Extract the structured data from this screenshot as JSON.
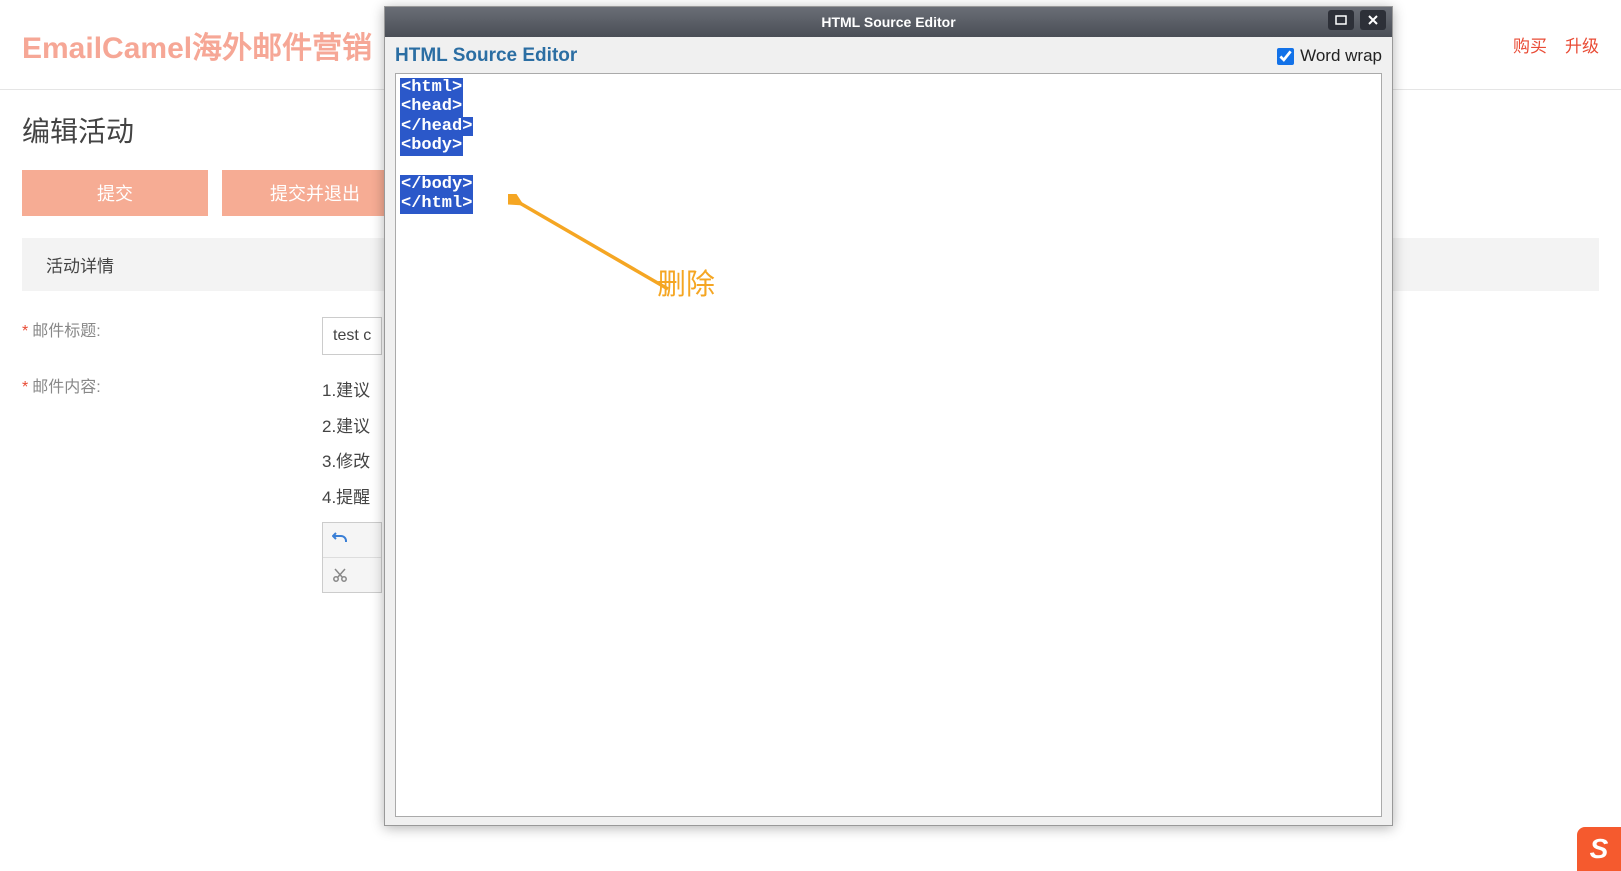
{
  "header": {
    "logo": "EmailCamel海外邮件营销",
    "links": {
      "buy": "购买",
      "upgrade": "升级"
    }
  },
  "page": {
    "title": "编辑活动",
    "buttons": {
      "submit": "提交",
      "submit_exit": "提交并退出"
    },
    "section_label": "活动详情",
    "labels": {
      "subject": "邮件标题:",
      "content": "邮件内容:"
    },
    "subject_value": "test c",
    "tips": [
      "1.建议",
      "2.建议",
      "3.修改",
      "4.提醒"
    ]
  },
  "dialog": {
    "title": "HTML Source Editor",
    "subtitle": "HTML Source Editor",
    "wordwrap_label": "Word wrap",
    "wordwrap_checked": true,
    "code_lines": [
      "<html>",
      "<head>",
      "</head>",
      "<body>",
      " ",
      "</body>",
      "</html>"
    ]
  },
  "annotation": {
    "text": "删除"
  },
  "ime": {
    "letter": "S"
  }
}
